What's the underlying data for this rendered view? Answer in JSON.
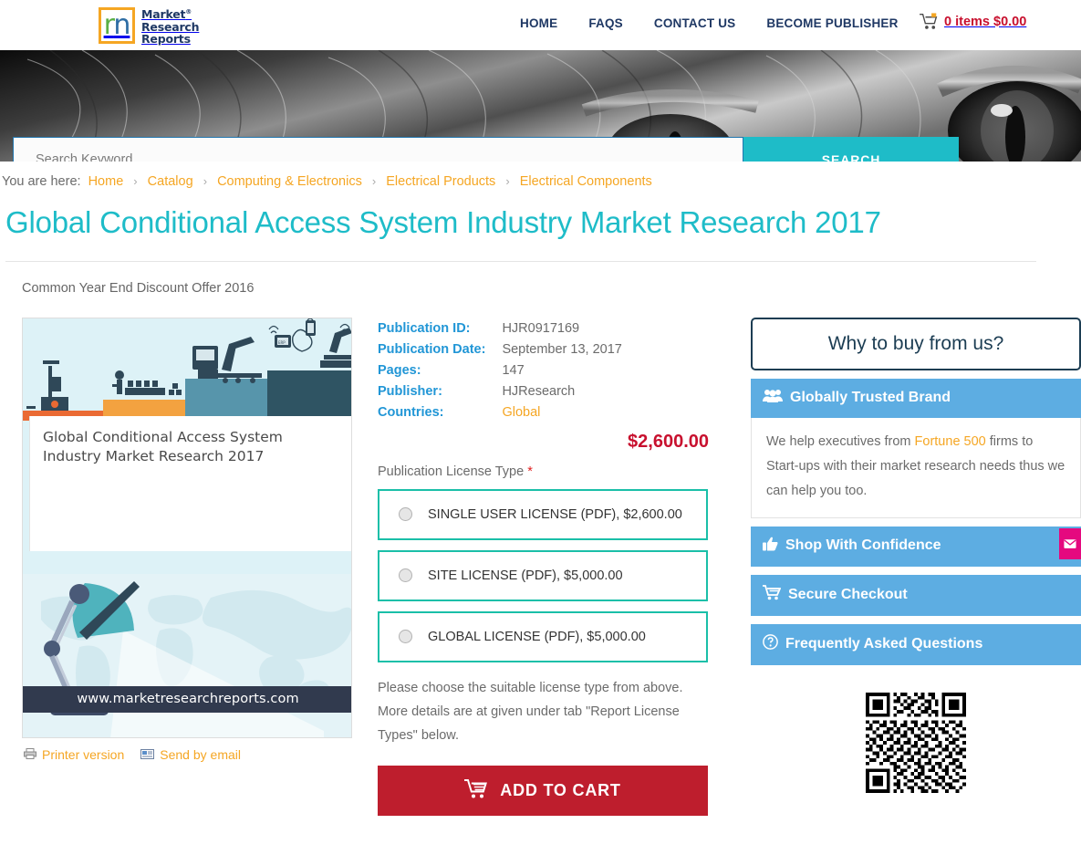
{
  "header": {
    "logo": {
      "letter": "m",
      "line1": "Market",
      "line2": "Research",
      "line3": "Reports",
      "registered": "®"
    },
    "nav": [
      {
        "label": "HOME"
      },
      {
        "label": "FAQS"
      },
      {
        "label": "CONTACT US"
      },
      {
        "label": "BECOME PUBLISHER"
      }
    ],
    "cart": {
      "icon": "shopping-cart-icon",
      "label": "0 items $0.00",
      "color": "#C8102E"
    }
  },
  "hero": {
    "search_placeholder": "Search Keyword",
    "search_value": "",
    "search_button": "SEARCH",
    "button_color": "#1EBCC8"
  },
  "breadcrumb": {
    "prefix": "You are here:",
    "separator": "›",
    "items": [
      {
        "label": "Home"
      },
      {
        "label": "Catalog"
      },
      {
        "label": "Computing & Electronics"
      },
      {
        "label": "Electrical Products"
      },
      {
        "label": "Electrical Components"
      }
    ],
    "link_color": "#F5A623"
  },
  "page": {
    "title": "Global Conditional Access System Industry Market Research 2017",
    "title_color": "#1EBCC8",
    "offer": "Common Year End Discount Offer 2016"
  },
  "cover": {
    "title": "Global Conditional Access System Industry Market Research 2017",
    "url": "www.marketresearchreports.com",
    "links": [
      {
        "label": "Printer version",
        "icon": "printer-icon"
      },
      {
        "label": "Send by email",
        "icon": "envelope-icon"
      }
    ]
  },
  "details": {
    "rows": [
      {
        "label": "Publication ID:",
        "value": "HJR0917169",
        "highlight": false
      },
      {
        "label": "Publication Date:",
        "value": "September 13, 2017",
        "highlight": false
      },
      {
        "label": "Pages:",
        "value": "147",
        "highlight": false
      },
      {
        "label": "Publisher:",
        "value": "HJResearch",
        "highlight": false
      },
      {
        "label": "Countries:",
        "value": "Global",
        "highlight": true
      }
    ],
    "price": "$2,600.00",
    "price_color": "#C8102E",
    "license_label": "Publication License Type",
    "license_required_mark": "*",
    "licenses": [
      {
        "label": "SINGLE USER LICENSE (PDF), $2,600.00",
        "selected": false
      },
      {
        "label": "SITE LICENSE (PDF), $5,000.00",
        "selected": false
      },
      {
        "label": "GLOBAL LICENSE (PDF), $5,000.00",
        "selected": false
      }
    ],
    "license_help": "Please choose the suitable license type from above. More details are at given under tab \"Report License Types\" below.",
    "add_to_cart": "ADD TO CART",
    "add_to_cart_color": "#BE1E2D",
    "license_border_color": "#1ABFA8"
  },
  "why": {
    "heading": "Why to buy from us?",
    "heading_border_color": "#1C3D53",
    "bar_color": "#5DADE2",
    "items": [
      {
        "title": "Globally Trusted Brand",
        "icon": "users-icon",
        "body_prefix": "We help executives from ",
        "body_highlight": "Fortune 500",
        "body_suffix": " firms to Start-ups with their market research needs thus we can help you too."
      },
      {
        "title": "Shop With Confidence",
        "icon": "thumbs-up-icon"
      },
      {
        "title": "Secure Checkout",
        "icon": "cart-icon"
      },
      {
        "title": "Frequently Asked Questions",
        "icon": "question-circle-icon"
      }
    ]
  },
  "floating": {
    "email_tab_icon": "envelope-icon",
    "email_tab_color": "#E5097F"
  }
}
